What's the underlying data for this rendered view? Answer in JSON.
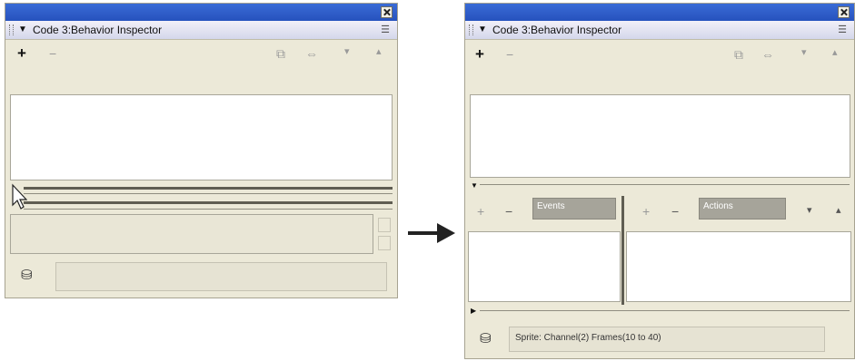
{
  "panels": {
    "left": {
      "title": "Code 3:Behavior Inspector"
    },
    "right": {
      "title": "Code 3:Behavior Inspector",
      "events_label": "Events",
      "actions_label": "Actions",
      "status_text": "Sprite:   Channel(2)   Frames(10 to 40)"
    }
  },
  "icons": {
    "close": "close-icon",
    "collapse": "collapse-triangle-icon",
    "options": "panel-options-icon",
    "add": "add-behavior-icon",
    "remove": "remove-behavior-icon",
    "shuffle_up": "shuffle-up-icon",
    "shuffle_down": "shuffle-down-icon",
    "script": "script-window-icon",
    "parameters": "parameters-icon",
    "behavior": "behavior-icon"
  },
  "colors": {
    "titlebar": "#2652bd",
    "panel_bg": "#ece9d8",
    "gray_field": "#a6a49a"
  }
}
